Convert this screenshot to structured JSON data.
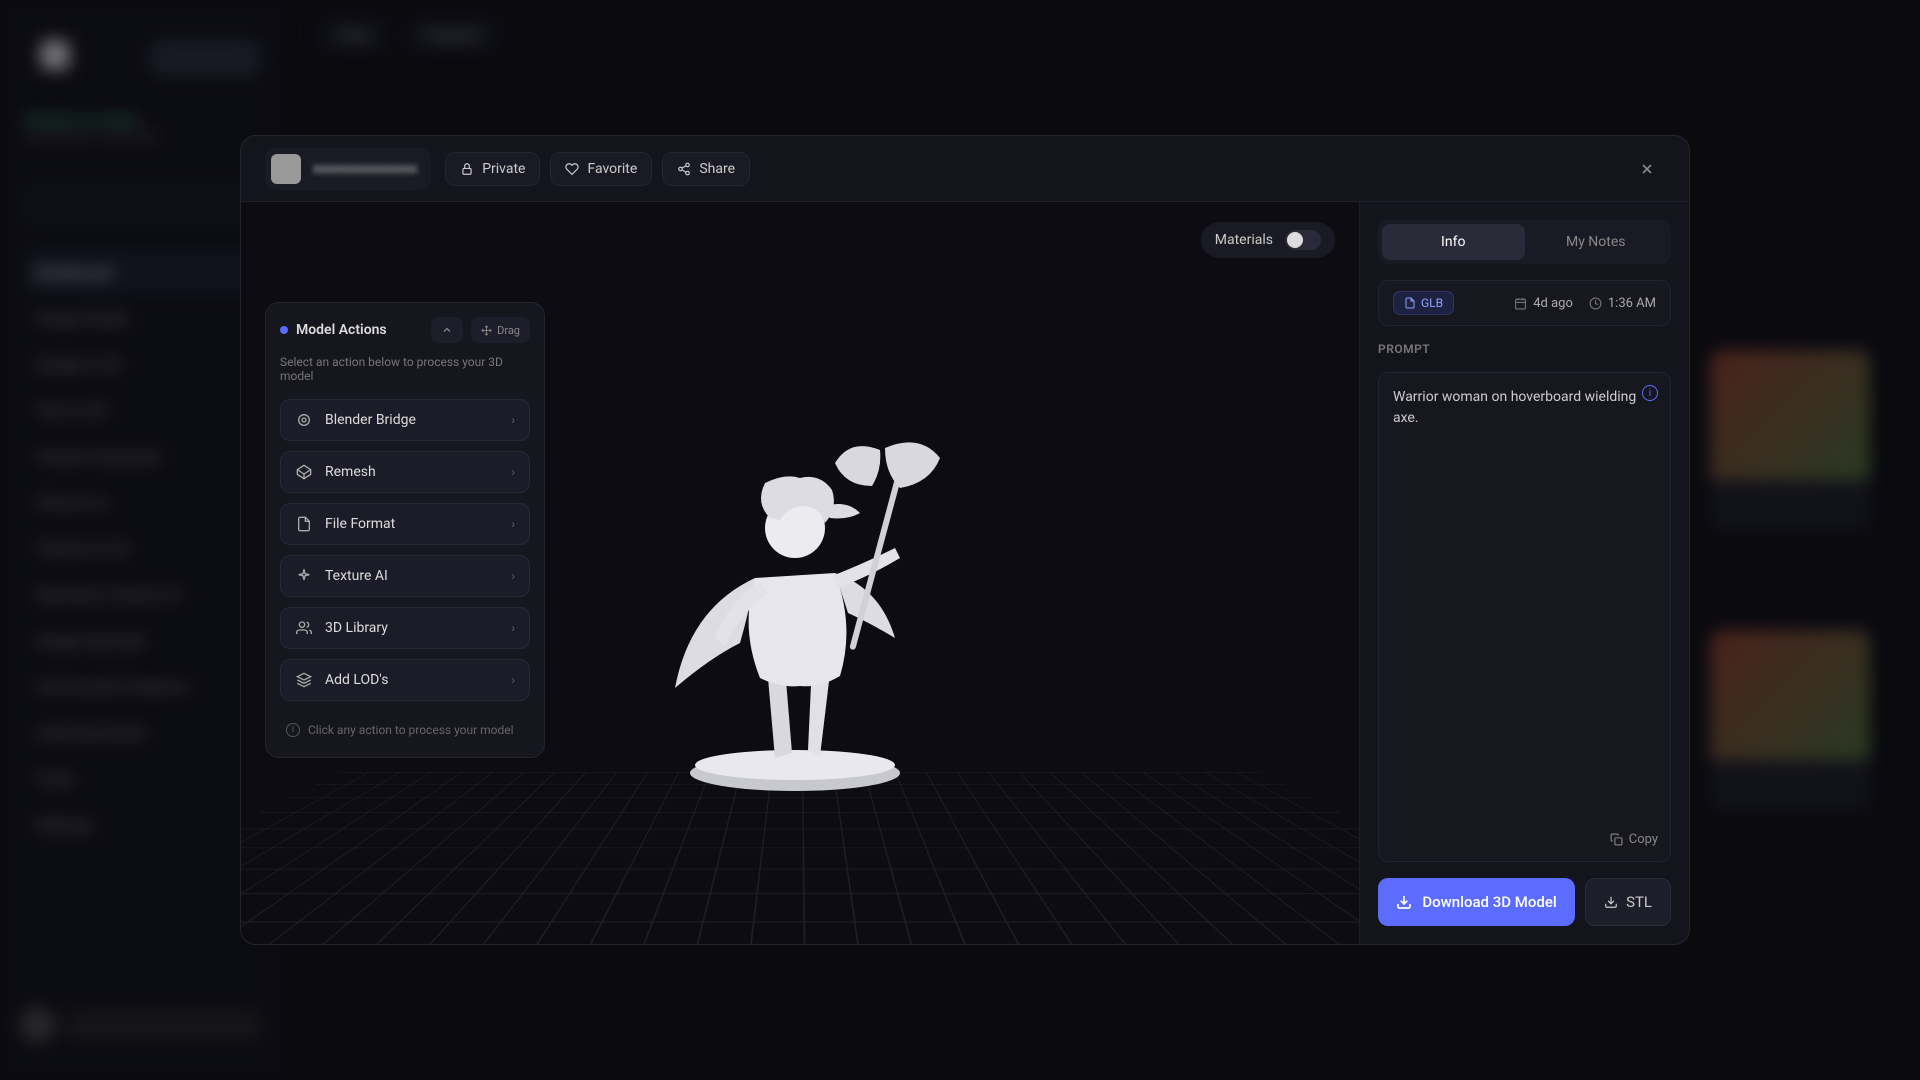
{
  "bg": {
    "status_title": "Ready to Create",
    "status_sub": "All systems unlocked",
    "nav_items": [
      "Dashboard",
      "Image Studio",
      "Image to 2D",
      "Text to 3D",
      "Texture Generator",
      "Texture AI",
      "Texture AI V2",
      "Seamless Texture AI",
      "Image Upscaler",
      "Community Creations",
      "Learning Studio",
      "Tools",
      "Settings"
    ],
    "topbar_files": "Files",
    "topbar_projects": "Projects"
  },
  "header": {
    "private": "Private",
    "favorite": "Favorite",
    "share": "Share"
  },
  "viewport": {
    "materials_label": "Materials"
  },
  "actions": {
    "title": "Model Actions",
    "drag": "Drag",
    "subtitle": "Select an action below to process your 3D model",
    "items": [
      {
        "label": "Blender Bridge"
      },
      {
        "label": "Remesh"
      },
      {
        "label": "File Format"
      },
      {
        "label": "Texture AI"
      },
      {
        "label": "3D Library"
      },
      {
        "label": "Add LOD's"
      }
    ],
    "footer": "Click any action to process your model"
  },
  "right": {
    "tab_info": "Info",
    "tab_notes": "My Notes",
    "format": "GLB",
    "ago": "4d ago",
    "time": "1:36 AM",
    "prompt_label": "PROMPT",
    "prompt_text": "Warrior woman on hoverboard wielding axe.",
    "copy": "Copy",
    "download": "Download 3D Model",
    "stl": "STL"
  }
}
